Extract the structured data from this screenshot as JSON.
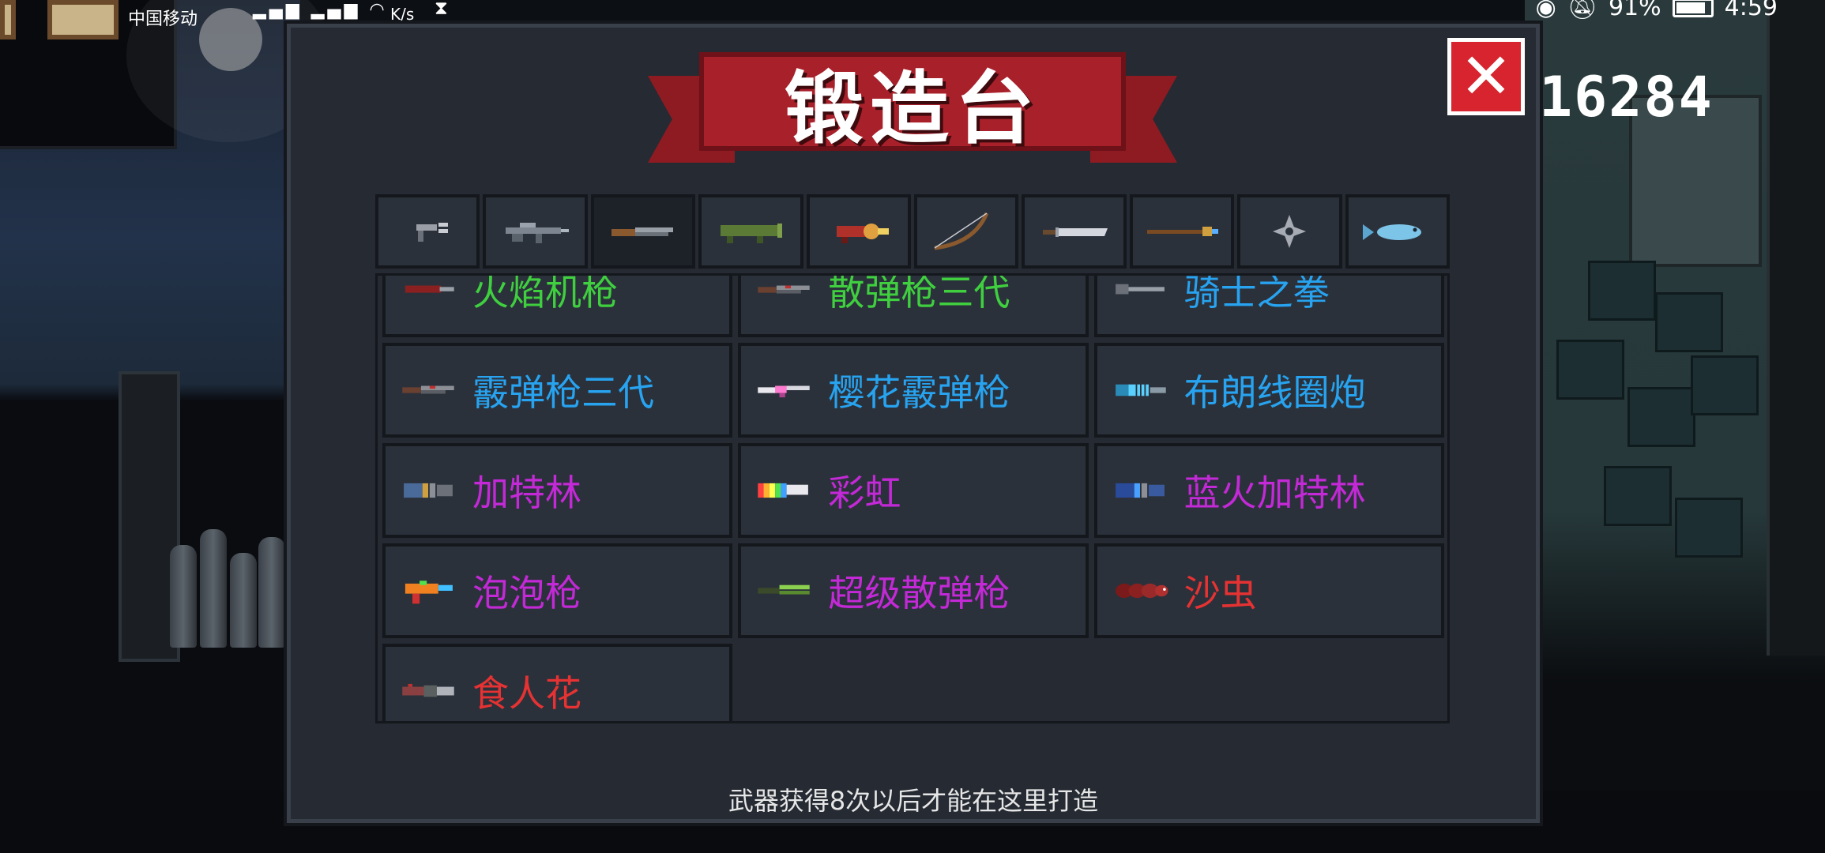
{
  "status_bar": {
    "carrier": "中国移动",
    "speed": "K/s",
    "battery": "91%",
    "time": "4:59"
  },
  "title": "锻造台",
  "coins": "16284",
  "colors": {
    "blue": "#27a3f0",
    "purple": "#c329d6",
    "red": "#e63232",
    "green": "#3fcf3f"
  },
  "tabs": [
    {
      "name": "pistol",
      "active": false
    },
    {
      "name": "rifle",
      "active": false
    },
    {
      "name": "shotgun",
      "active": true
    },
    {
      "name": "rocket-launcher",
      "active": false
    },
    {
      "name": "flamethrower",
      "active": false
    },
    {
      "name": "bow",
      "active": false
    },
    {
      "name": "sword",
      "active": false
    },
    {
      "name": "staff",
      "active": false
    },
    {
      "name": "shuriken",
      "active": false
    },
    {
      "name": "fish",
      "active": false
    }
  ],
  "weapons": [
    {
      "name": "火焰机枪",
      "color": "green",
      "icon": "cannon"
    },
    {
      "name": "散弹枪三代",
      "color": "green",
      "icon": "shotgun"
    },
    {
      "name": "骑士之拳",
      "color": "blue",
      "icon": "fist"
    },
    {
      "name": "霰弹枪三代",
      "color": "blue",
      "icon": "shotgun"
    },
    {
      "name": "樱花霰弹枪",
      "color": "blue",
      "icon": "pink-shotgun"
    },
    {
      "name": "布朗线圈炮",
      "color": "blue",
      "icon": "coil-gun"
    },
    {
      "name": "加特林",
      "color": "purple",
      "icon": "gatling"
    },
    {
      "name": "彩虹",
      "color": "purple",
      "icon": "rainbow-gun"
    },
    {
      "name": "蓝火加特林",
      "color": "purple",
      "icon": "blue-gatling"
    },
    {
      "name": "泡泡枪",
      "color": "purple",
      "icon": "bubble-gun"
    },
    {
      "name": "超级散弹枪",
      "color": "purple",
      "icon": "super-shotgun"
    },
    {
      "name": "沙虫",
      "color": "red",
      "icon": "sandworm"
    },
    {
      "name": "食人花",
      "color": "red",
      "icon": "piranha-plant"
    }
  ],
  "footer_hint": "武器获得8次以后才能在这里打造"
}
